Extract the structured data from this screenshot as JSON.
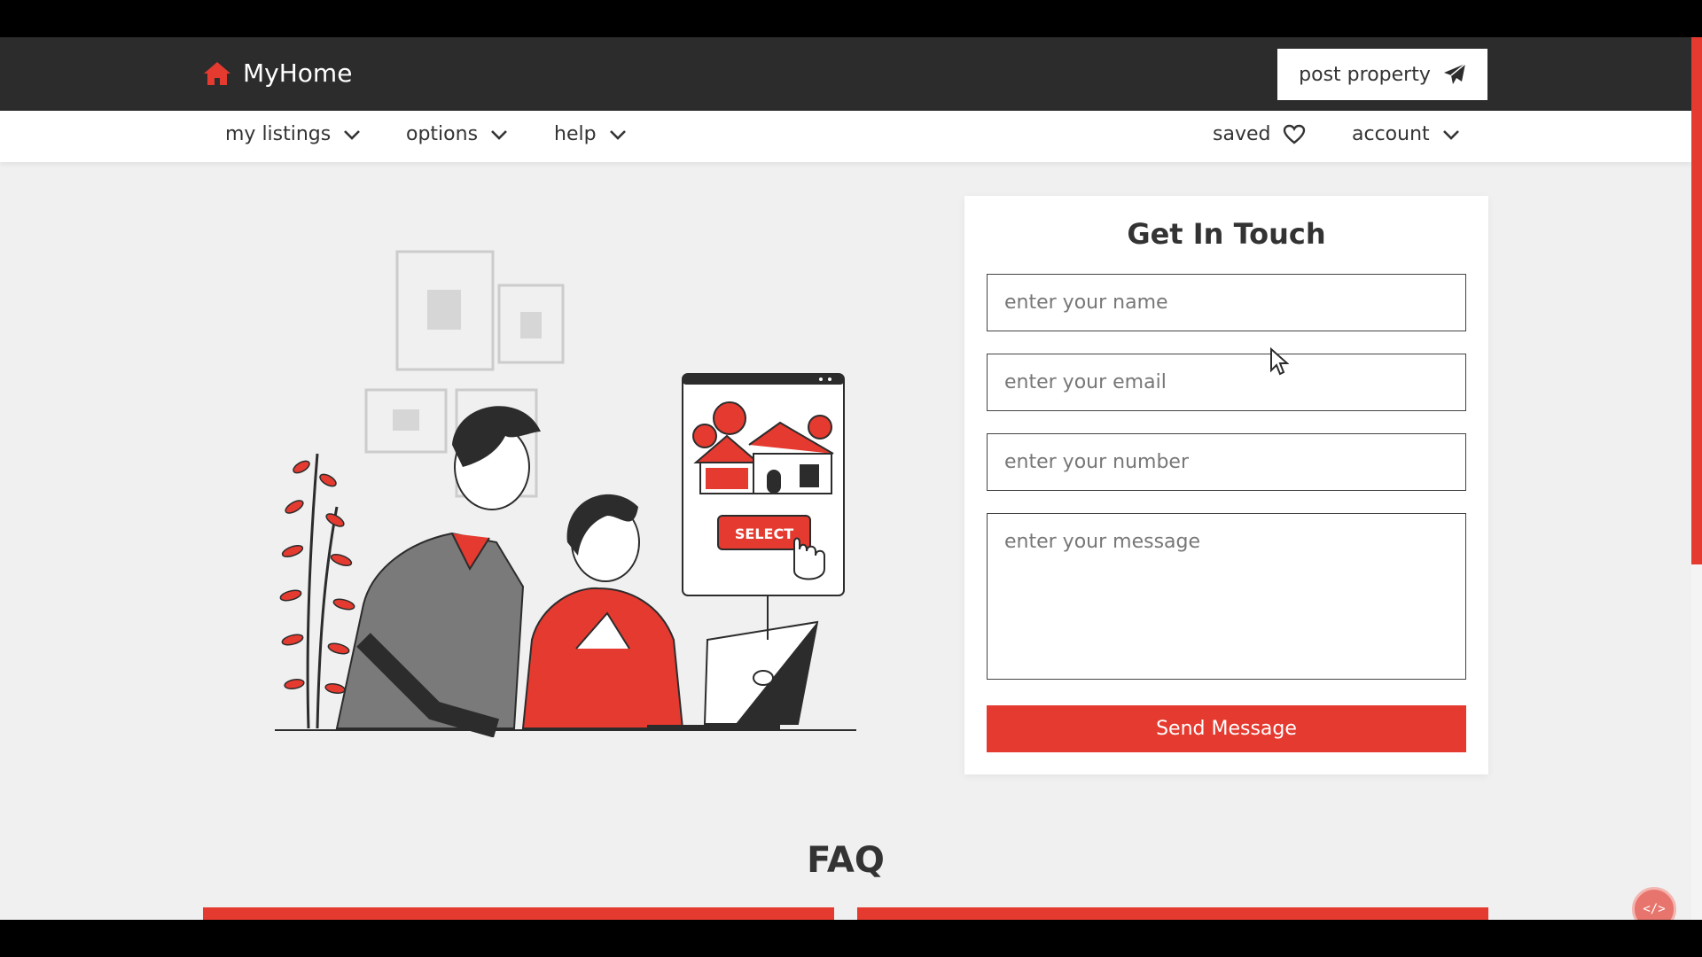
{
  "header": {
    "logo_text": "MyHome",
    "post_property_label": "post property"
  },
  "nav": {
    "items": [
      {
        "label": "my listings"
      },
      {
        "label": "options"
      },
      {
        "label": "help"
      }
    ],
    "saved_label": "saved",
    "account_label": "account"
  },
  "illustration": {
    "button_text": "SELECT"
  },
  "contact": {
    "title": "Get In Touch",
    "name_placeholder": "enter your name",
    "email_placeholder": "enter your email",
    "number_placeholder": "enter your number",
    "message_placeholder": "enter your message",
    "send_label": "Send Message"
  },
  "faq": {
    "title": "FAQ"
  },
  "widget": {
    "code_label": "</>"
  },
  "colors": {
    "accent": "#e53a2f",
    "header_bg": "#2d2c2c",
    "page_bg": "#f0f0f0"
  }
}
